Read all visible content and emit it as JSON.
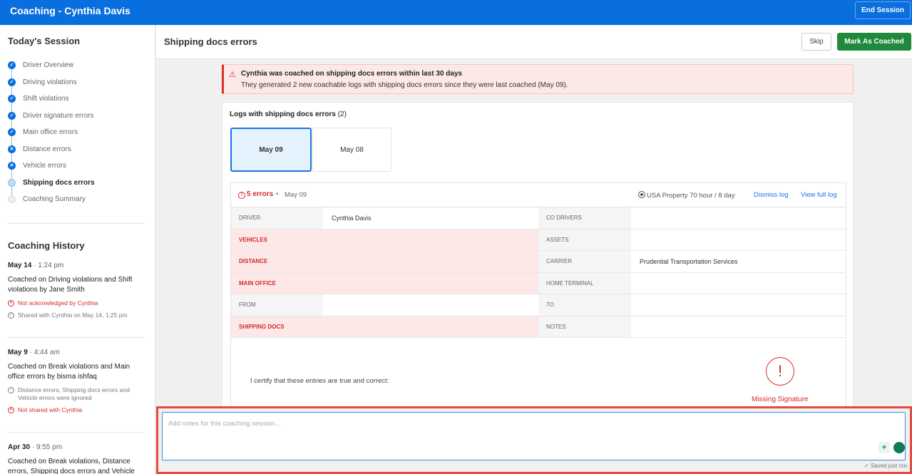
{
  "topbar": {
    "title": "Coaching - Cynthia Davis",
    "end_label": "End Session"
  },
  "session": {
    "title": "Today's Session",
    "steps": [
      {
        "label": "Driver Overview",
        "state": "check"
      },
      {
        "label": "Driving violations",
        "state": "check"
      },
      {
        "label": "Shift violations",
        "state": "check"
      },
      {
        "label": "Driver signature errors",
        "state": "check"
      },
      {
        "label": "Main office errors",
        "state": "check"
      },
      {
        "label": "Distance errors",
        "state": "cross"
      },
      {
        "label": "Vehicle errors",
        "state": "cross"
      },
      {
        "label": "Shipping docs errors",
        "state": "current"
      },
      {
        "label": "Coaching Summary",
        "state": "future"
      }
    ]
  },
  "history": {
    "title": "Coaching History",
    "entries": [
      {
        "date": "May 14",
        "time": "1:24 pm",
        "desc": "Coached on Driving violations and Shift violations by Jane Smith",
        "notes": [
          {
            "text": "Not acknowledged by Cynthia",
            "color": "red"
          },
          {
            "text": "Shared with Cynthia on May 14, 1:25 pm",
            "color": "grey"
          }
        ]
      },
      {
        "date": "May 9",
        "time": "4:44 am",
        "desc": "Coached on Break violations and Main office errors by bisma ishfaq",
        "notes": [
          {
            "text": "Distance errors, Shipping docs errors and Vehicle errors were ignored",
            "color": "grey"
          },
          {
            "text": "Not shared with Cynthia",
            "color": "red"
          }
        ]
      },
      {
        "date": "Apr 30",
        "time": "9:55 pm",
        "desc": "Coached on Break violations, Distance errors, Shipping docs errors and Vehicle errors",
        "notes": []
      }
    ]
  },
  "header": {
    "title": "Shipping docs errors",
    "skip_label": "Skip",
    "coached_label": "Mark As Coached"
  },
  "alert": {
    "title": "Cynthia was coached on shipping docs errors within last 30 days",
    "body": "They generated 2 new coachable logs with shipping docs errors since they were last coached (May 09)."
  },
  "logs": {
    "heading": "Logs with shipping docs errors",
    "count": "(2)",
    "cards": [
      "May 09",
      "May 08"
    ],
    "selected": "May 09"
  },
  "log": {
    "errors": "5 errors",
    "sep": "•",
    "date": "May 09",
    "ruleset": "USA Property 70 hour / 8 day",
    "dismiss": "Dismiss log",
    "view": "View full log",
    "rows": [
      {
        "k1": "Driver",
        "v1": "Cynthia Davis",
        "e1": false,
        "k2": "Co Drivers",
        "v2": ""
      },
      {
        "k1": "Vehicles",
        "v1": "",
        "e1": true,
        "k2": "Assets",
        "v2": ""
      },
      {
        "k1": "Distance",
        "v1": "",
        "e1": true,
        "k2": "Carrier",
        "v2": "Prudential Transportation Services"
      },
      {
        "k1": "Main Office",
        "v1": "",
        "e1": true,
        "k2": "Home Terminal",
        "v2": ""
      },
      {
        "k1": "From",
        "v1": "",
        "e1": false,
        "k2": "To",
        "v2": ""
      },
      {
        "k1": "Shipping Docs",
        "v1": "",
        "e1": true,
        "k2": "Notes",
        "v2": ""
      }
    ],
    "cert": "I certify that these entries are true and correct:",
    "missing_sig": "Missing Signature"
  },
  "notes": {
    "placeholder": "Add notes for this coaching session...",
    "saved": "Saved just now"
  },
  "colors": {
    "primary": "#0a6fde",
    "success": "#1f8a3b",
    "error": "#d42b2b",
    "highlight": "#e54b3c"
  }
}
